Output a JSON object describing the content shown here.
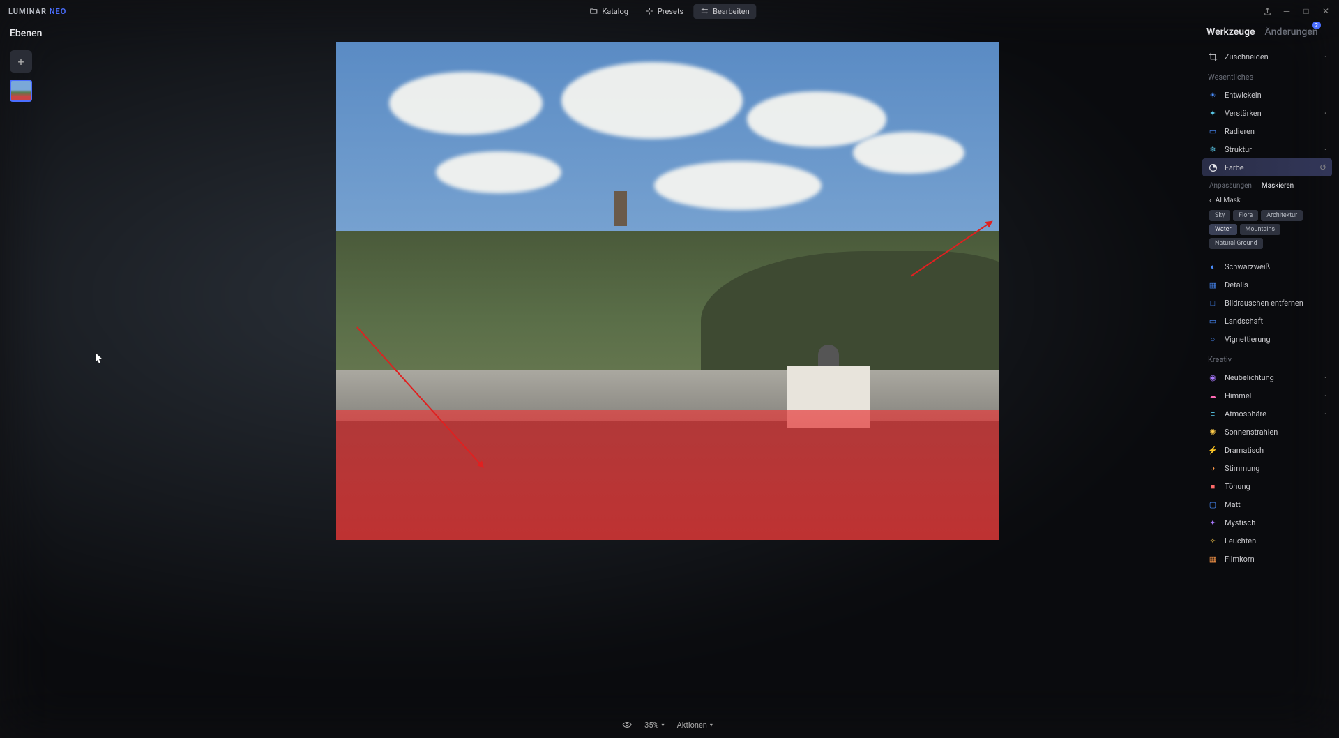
{
  "app": {
    "name": "LUMINAR",
    "suffix": "NEO"
  },
  "topnav": {
    "katalog": "Katalog",
    "presets": "Presets",
    "bearbeiten": "Bearbeiten"
  },
  "left": {
    "title": "Ebenen"
  },
  "bottom": {
    "zoom": "35%",
    "actions": "Aktionen"
  },
  "right": {
    "tabs": {
      "werkzeuge": "Werkzeuge",
      "aenderungen": "Änderungen",
      "badge": "2"
    },
    "crop": "Zuschneiden",
    "sections": {
      "wesentliches": "Wesentliches",
      "kreativ": "Kreativ"
    },
    "tools": {
      "entwickeln": "Entwickeln",
      "verstaerken": "Verstärken",
      "radieren": "Radieren",
      "struktur": "Struktur",
      "farbe": "Farbe",
      "schwarzweiss": "Schwarzweiß",
      "details": "Details",
      "bildrauschen": "Bildrauschen entfernen",
      "landschaft": "Landschaft",
      "vignettierung": "Vignettierung",
      "neubelichtung": "Neubelichtung",
      "himmel": "Himmel",
      "atmosphaere": "Atmosphäre",
      "sonnenstrahlen": "Sonnenstrahlen",
      "dramatisch": "Dramatisch",
      "stimmung": "Stimmung",
      "toenung": "Tönung",
      "matt": "Matt",
      "mystisch": "Mystisch",
      "leuchten": "Leuchten",
      "filmkorn": "Filmkorn"
    },
    "farbe_panel": {
      "tab_anpassungen": "Anpassungen",
      "tab_maskieren": "Maskieren",
      "ai_mask": "AI Mask",
      "chips": {
        "sky": "Sky",
        "flora": "Flora",
        "architektur": "Architektur",
        "water": "Water",
        "mountains": "Mountains",
        "natural_ground": "Natural Ground"
      }
    }
  }
}
